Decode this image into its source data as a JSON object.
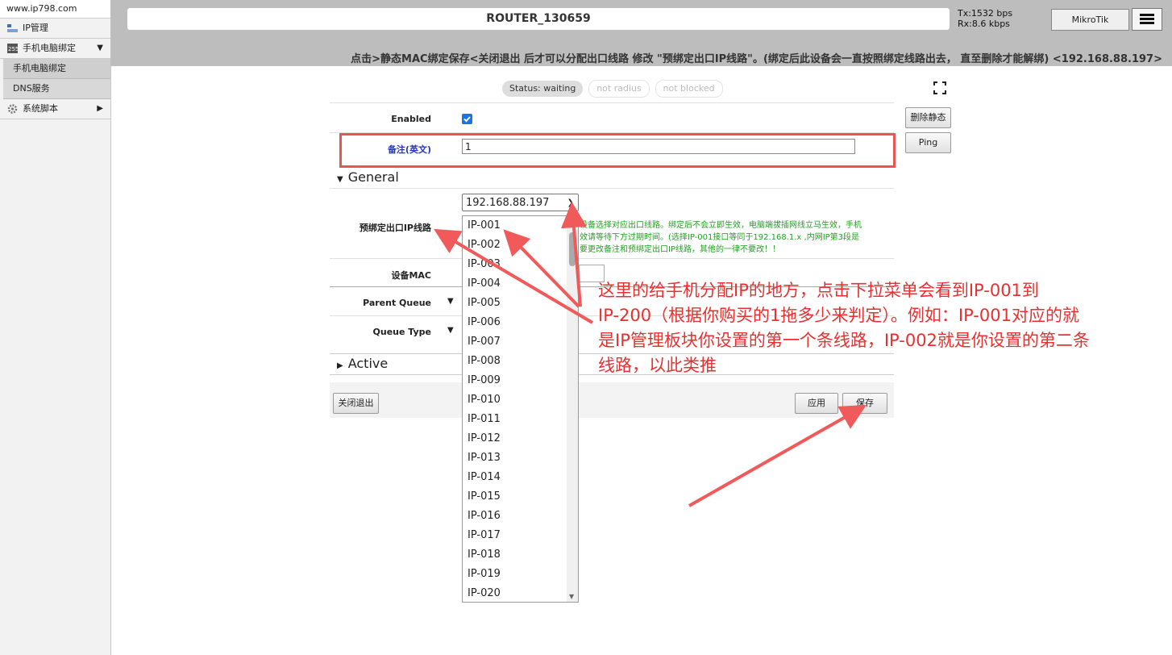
{
  "sidebar": {
    "site": "www.ip798.com",
    "items": [
      {
        "label": "IP管理",
        "icon": "ip-management-icon",
        "arrow": ""
      },
      {
        "label": "手机电脑绑定",
        "icon": "binding-icon",
        "arrow": "▼"
      }
    ],
    "sub_items": [
      {
        "label": "手机电脑绑定"
      },
      {
        "label": "DNS服务"
      }
    ],
    "script_item": {
      "label": "系统脚本",
      "icon": "gear-icon",
      "arrow": "▶"
    }
  },
  "header": {
    "router_name": "ROUTER_130659",
    "tx": "Tx:1532 bps",
    "rx": "Rx:8.6 kbps",
    "brand_button": "MikroTik",
    "notice": "点击>静态MAC绑定保存<关闭退出 后才可以分配出口线路 修改 \"预绑定出口IP线路\"。(绑定后此设备会一直按照绑定线路出去， 直至删除才能解绑) <192.168.88.197>"
  },
  "status": {
    "pills": [
      "Status: waiting",
      "not radius",
      "not blocked"
    ]
  },
  "side_buttons": {
    "delete_static": "删除静态",
    "ping": "Ping"
  },
  "form": {
    "enabled_label": "Enabled",
    "enabled_checked": true,
    "memo_label": "备注(英文)",
    "memo_value": "1",
    "general_section": "General",
    "preset_label": "预绑定出口IP线路",
    "selected_ip": "192.168.88.197",
    "hint_lines": [
      "设备选择对应出口线路。绑定后不会立即生效，电脑端拔插网线立马生效，手机",
      "效请等待下方过期时间。(选择IP-001接口等同于192.168.1.x ,内网IP第3段是",
      "要更改备注和预绑定出口IP线路，其他的一律不要改！！"
    ],
    "mac_label": "设备MAC",
    "parent_queue_label": "Parent Queue",
    "queue_type_label": "Queue Type",
    "active_section": "Active"
  },
  "dropdown_options": [
    "IP-001",
    "IP-002",
    "IP-003",
    "IP-004",
    "IP-005",
    "IP-006",
    "IP-007",
    "IP-008",
    "IP-009",
    "IP-010",
    "IP-011",
    "IP-012",
    "IP-013",
    "IP-014",
    "IP-015",
    "IP-016",
    "IP-017",
    "IP-018",
    "IP-019",
    "IP-020"
  ],
  "footer_buttons": {
    "close": "关闭退出",
    "apply": "应用",
    "save": "保存"
  },
  "annotation": {
    "lines": [
      "这里的给手机分配IP的地方，点击下拉菜单会看到IP-001到",
      "IP-200（根据你购买的1拖多少来判定）。例如：IP-001对应的就",
      "是IP管理板块你设置的第一个条线路，IP-002就是你设置的第二条",
      "线路，以此类推"
    ]
  },
  "colors": {
    "annotation_red": "#e83030",
    "hint_green": "#22a022",
    "header_gray": "#bdbdbd"
  }
}
